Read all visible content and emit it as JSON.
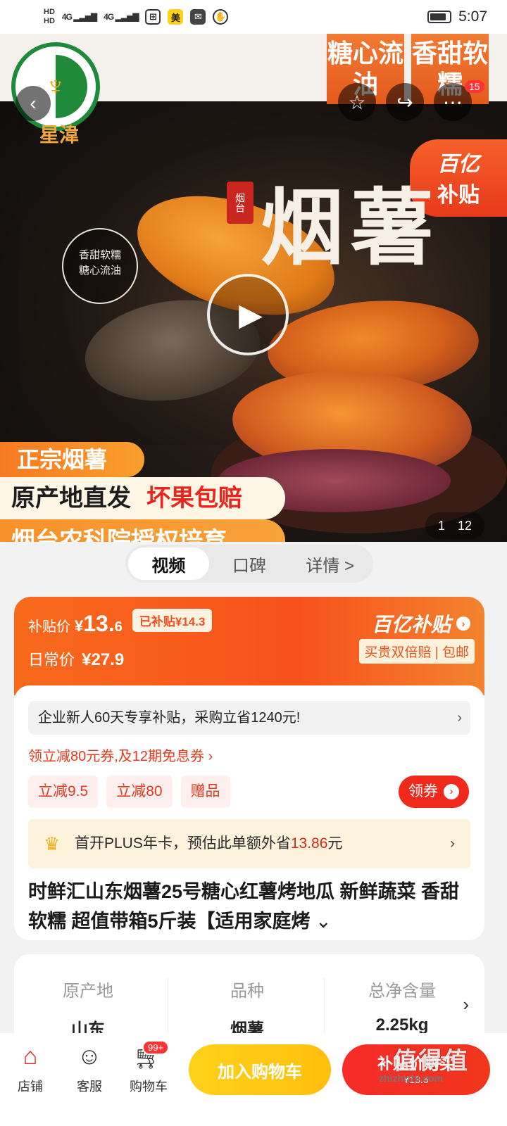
{
  "status_bar": {
    "hd1": "HD",
    "hd2": "HD",
    "sig1": "4G",
    "sig2": "4G",
    "app_mei": "美",
    "time": "5:07"
  },
  "hero": {
    "brand": "星湋",
    "corner_tag_1": "糖心流油",
    "corner_tag_2": "香甜软糯",
    "notif_count": "15",
    "subsidy_l1": "百亿",
    "subsidy_l2": "补贴",
    "headline": "烟薯",
    "seal_text": "烟台",
    "stamp_line1": "香甜软糯",
    "stamp_line2": "糖心流油",
    "tag_authentic": "正宗烟薯",
    "tag_origin": "原产地直发",
    "tag_refund": "坏果包赔",
    "tag_academy": "烟台农科院授权培育",
    "image_index": "1",
    "image_total": "12"
  },
  "tabs": [
    {
      "label": "视频",
      "active": true
    },
    {
      "label": "口碑",
      "active": false
    },
    {
      "label": "详情 >",
      "active": false
    }
  ],
  "price": {
    "subsidy_label": "补贴价",
    "currency": "¥",
    "subsidy_int": "13.",
    "subsidy_dec": "6",
    "already_subsidized": "已补贴¥14.3",
    "daily_label": "日常价",
    "daily_value": "¥27.9",
    "brand": "百亿补贴",
    "guarantee": "买贵双倍赔 | 包邮"
  },
  "promo": {
    "new_user": "企业新人60天专享补贴，采购立省1240元!",
    "coupon_line": "领立减80元券,及12期免息券 ›",
    "chips": [
      "立减9.5",
      "立减80",
      "赠品"
    ],
    "get_coupon": "领券",
    "plus_prefix": "首开PLUS年卡，预估此单额外省",
    "plus_amount": "13.86",
    "plus_suffix": "元"
  },
  "product": {
    "title": "时鲜汇山东烟薯25号糖心红薯烤地瓜 新鲜蔬菜 香甜软糯 超值带箱5斤装【适用家庭烤"
  },
  "specs": [
    {
      "key": "原产地",
      "value": "山东"
    },
    {
      "key": "品种",
      "value": "烟薯"
    },
    {
      "key": "总净含量",
      "value": "2.25kg"
    }
  ],
  "bottom_bar": {
    "shop": "店铺",
    "service": "客服",
    "cart": "购物车",
    "cart_badge": "99+",
    "add_to_cart": "加入购物车",
    "buy_l1": "补贴价购买",
    "buy_l2": "¥13.6"
  },
  "watermark": {
    "text": "值得值",
    "url": "zhizhizhi.com"
  },
  "colors": {
    "accent_orange": "#f7511c",
    "buy_red": "#f2361c",
    "cart_yellow": "#ffc814"
  }
}
